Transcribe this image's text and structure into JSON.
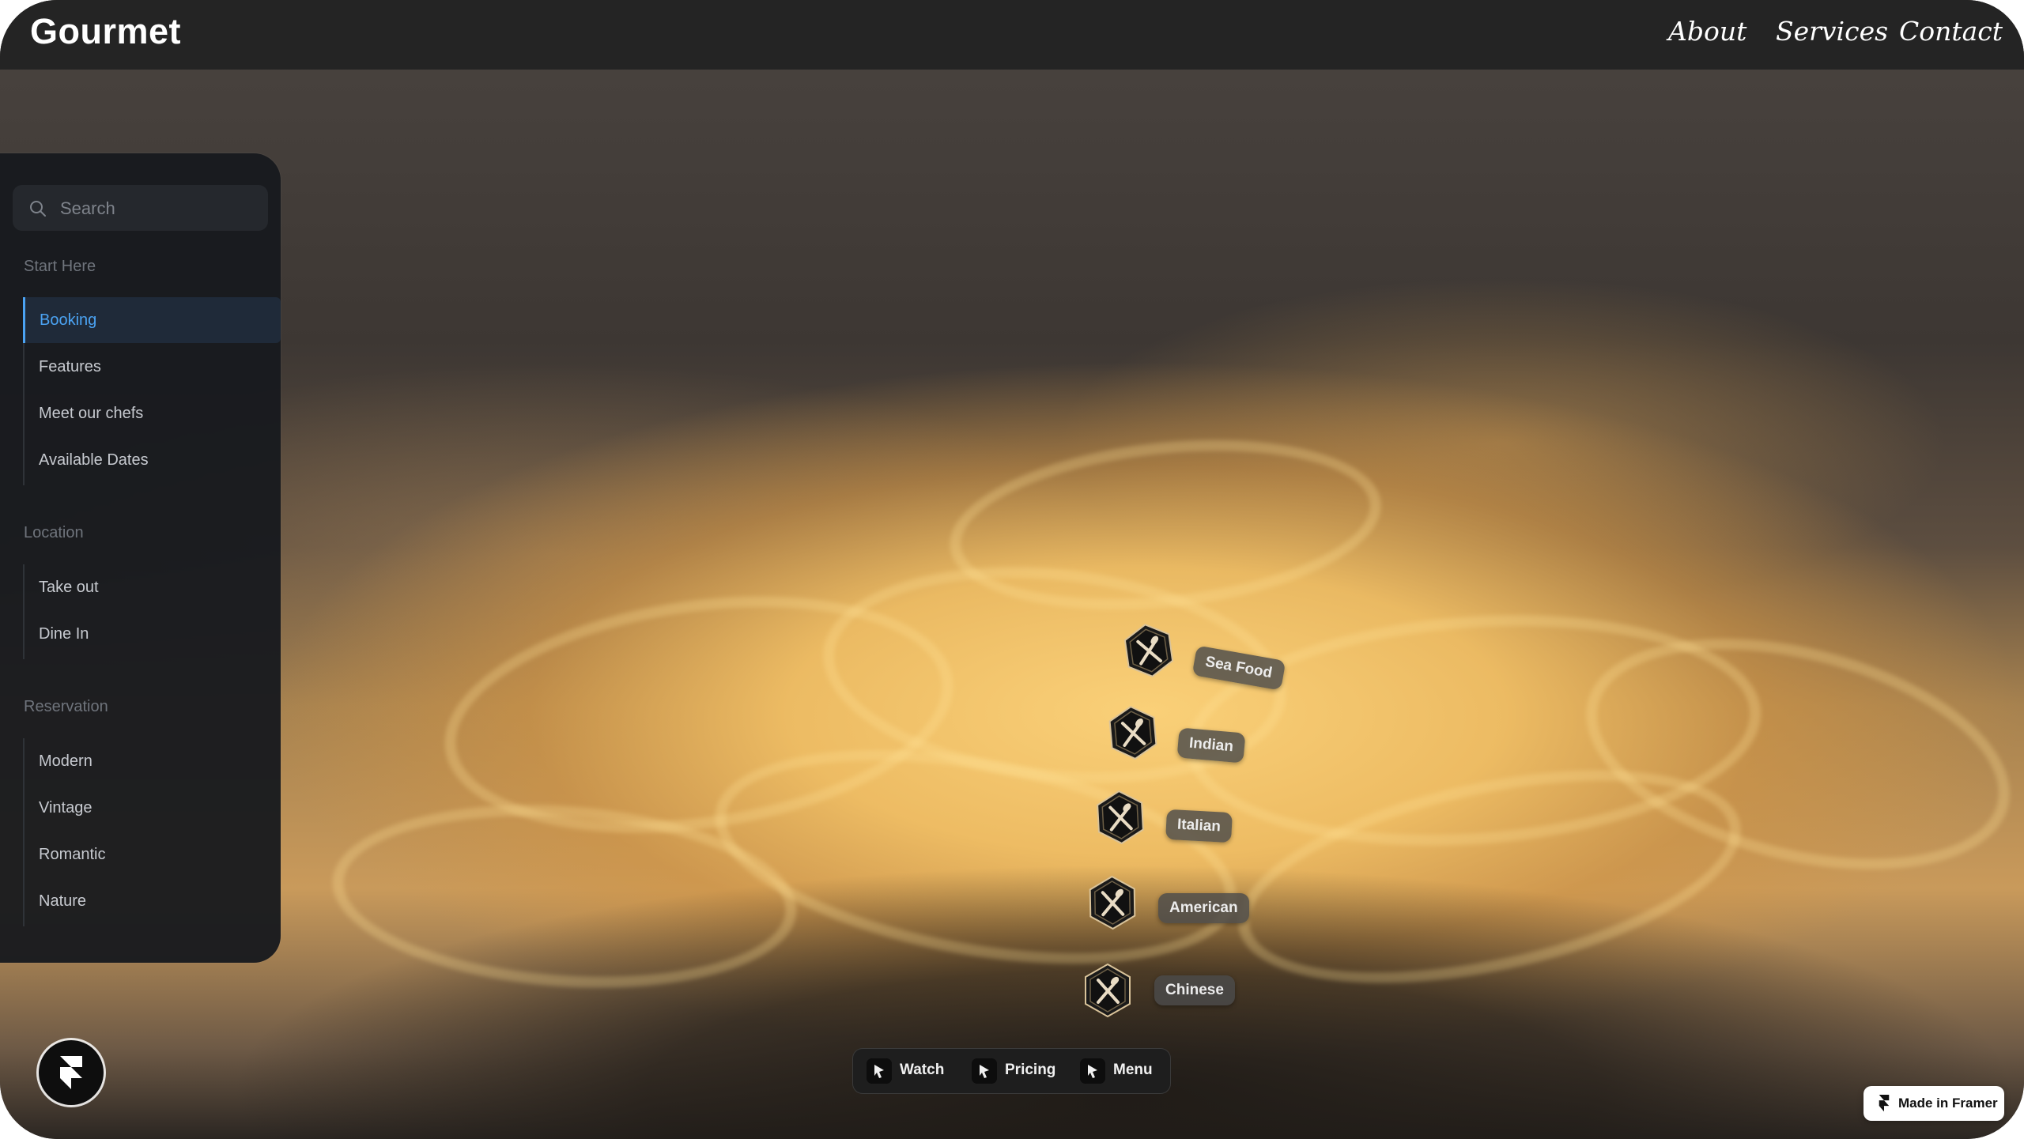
{
  "header": {
    "logo": "Gourmet",
    "nav": [
      {
        "label": "About"
      },
      {
        "label": "Services"
      },
      {
        "label": "Contact"
      }
    ]
  },
  "sidebar": {
    "search_placeholder": "Search",
    "sections": [
      {
        "title": "Start Here",
        "items": [
          {
            "label": "Booking",
            "active": true
          },
          {
            "label": "Features"
          },
          {
            "label": "Meet our chefs"
          },
          {
            "label": "Available Dates"
          }
        ]
      },
      {
        "title": "Location",
        "items": [
          {
            "label": "Take out"
          },
          {
            "label": "Dine In"
          }
        ]
      },
      {
        "title": "Reservation",
        "items": [
          {
            "label": "Modern"
          },
          {
            "label": "Vintage"
          },
          {
            "label": "Romantic"
          },
          {
            "label": "Nature"
          }
        ]
      }
    ]
  },
  "cuisines": [
    {
      "label": "Sea Food",
      "icon": "fork-spoon-icon"
    },
    {
      "label": "Indian",
      "icon": "fork-spoon-icon"
    },
    {
      "label": "Italian",
      "icon": "fork-spoon-icon"
    },
    {
      "label": "American",
      "icon": "fork-spoon-icon"
    },
    {
      "label": "Chinese",
      "icon": "fork-spoon-icon"
    }
  ],
  "bottom_bar": [
    {
      "label": "Watch"
    },
    {
      "label": "Pricing"
    },
    {
      "label": "Menu"
    }
  ],
  "badge": {
    "label": "Made in Framer"
  },
  "colors": {
    "topbar": "#242424",
    "sidebar": "#181a1e",
    "accent": "#4ba3f3",
    "tag": "#4b4b4b"
  }
}
